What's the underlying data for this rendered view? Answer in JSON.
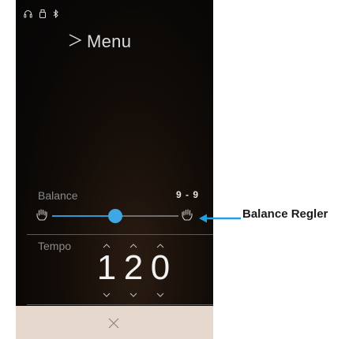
{
  "status_icons": [
    "headphones-icon",
    "usb-drive-icon",
    "bluetooth-icon"
  ],
  "menu": {
    "label": "Menu",
    "icon": "play-outline-icon"
  },
  "balance": {
    "label": "Balance",
    "value": "9 - 9",
    "position_fraction": 0.5
  },
  "tempo": {
    "label": "Tempo",
    "digits": [
      "1",
      "2",
      "0"
    ]
  },
  "close": {
    "icon": "close-icon"
  },
  "callout": {
    "label": "Balance Regler"
  },
  "colors": {
    "accent": "#3fa7e3",
    "close_bar": "#e7d8ce",
    "callout_arrow": "#1d9fe0"
  }
}
